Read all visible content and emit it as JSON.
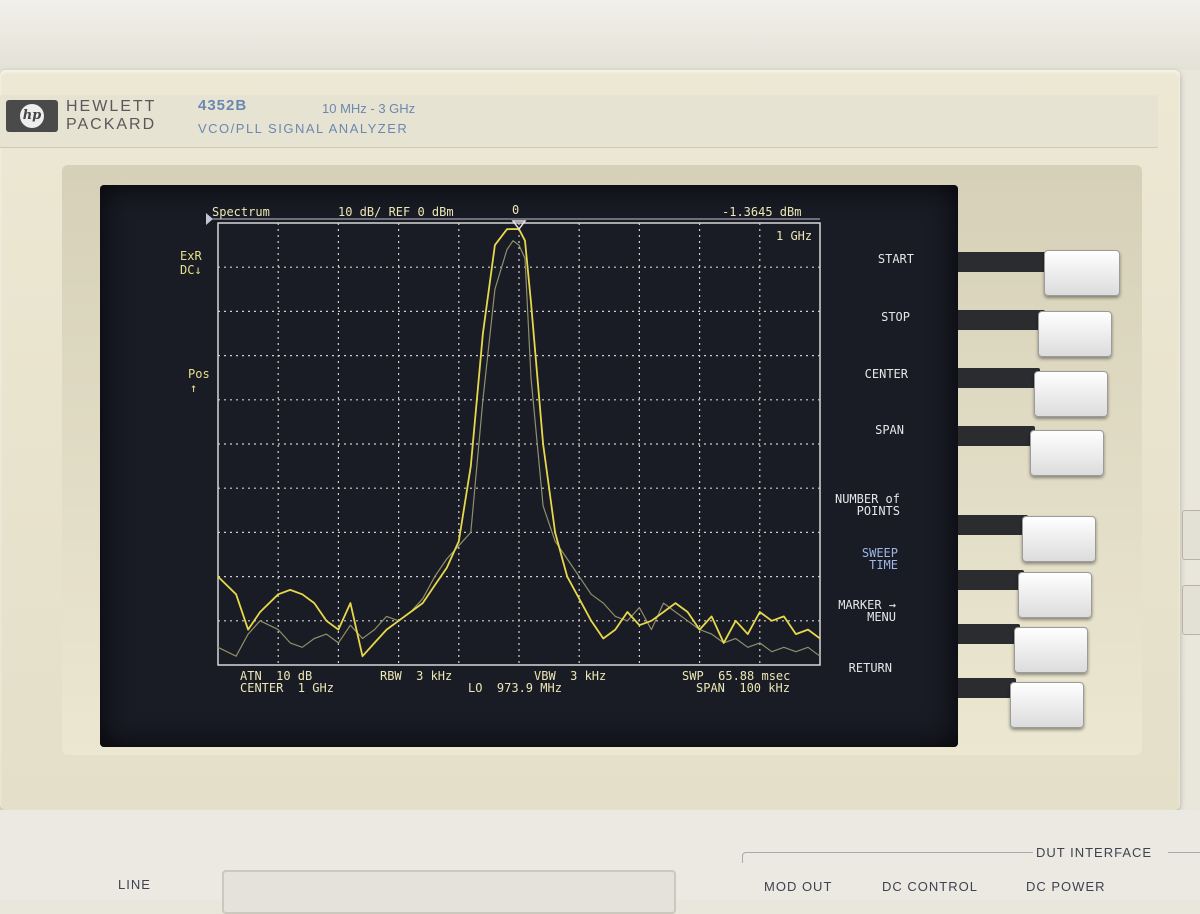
{
  "brand": {
    "line1": "HEWLETT",
    "line2": "PACKARD",
    "logo": "hp"
  },
  "instrument": {
    "model": "4352B",
    "range": "10 MHz - 3 GHz",
    "description": "VCO/PLL  SIGNAL  ANALYZER"
  },
  "screen": {
    "mode": "Spectrum",
    "scale": "10 dB/ REF 0 dBm",
    "marker_id": "0",
    "marker_value": "-1.3645 dBm",
    "marker_freq": "1 GHz",
    "left_annotations": {
      "exr_line1": "ExR",
      "exr_line2": "DC↓",
      "pos_line1": "Pos",
      "pos_line2": "↑"
    },
    "bottom": {
      "atn": "ATN  10 dB",
      "center": "CENTER  1 GHz",
      "rbw": "RBW  3 kHz",
      "lo": "LO  973.9 MHz",
      "vbw": "VBW  3 kHz",
      "swp": "SWP  65.88 msec",
      "span": "SPAN  100 kHz"
    }
  },
  "softkeys": [
    {
      "label": "START"
    },
    {
      "label": "STOP"
    },
    {
      "label": "CENTER"
    },
    {
      "label": "SPAN"
    },
    {
      "label": "NUMBER of\nPOINTS"
    },
    {
      "label": "SWEEP\nTIME"
    },
    {
      "label": "MARKER →\nMENU"
    },
    {
      "label": "RETURN"
    }
  ],
  "lower_panel": {
    "line_label": "LINE",
    "dut_interface": "DUT INTERFACE",
    "mod_out": "MOD OUT",
    "dc_control": "DC CONTROL",
    "dc_power": "DC POWER"
  },
  "chart_data": {
    "type": "line",
    "title": "Spectrum",
    "x": [
      -50,
      -47,
      -45,
      -43,
      -40,
      -38,
      -36,
      -34,
      -32,
      -30,
      -28,
      -26,
      -24,
      -22,
      -20,
      -18,
      -16,
      -14,
      -12,
      -10,
      -8,
      -6,
      -4,
      -2,
      -1,
      0,
      1,
      2,
      4,
      6,
      8,
      10,
      12,
      14,
      16,
      18,
      20,
      22,
      24,
      26,
      28,
      30,
      32,
      34,
      36,
      38,
      40,
      42,
      44,
      46,
      48,
      50
    ],
    "series": [
      {
        "values": [
          -80,
          -84,
          -92,
          -88,
          -84,
          -83,
          -84,
          -86,
          -90,
          -92,
          -86,
          -98,
          -95,
          -92,
          -90,
          -88,
          -86,
          -82,
          -78,
          -72,
          -55,
          -25,
          -5,
          -1.4,
          -1.36,
          -1.4,
          -4,
          -18,
          -50,
          -70,
          -80,
          -85,
          -90,
          -94,
          -92,
          -88,
          -91,
          -90,
          -88,
          -86,
          -88,
          -92,
          -89,
          -95,
          -90,
          -93,
          -88,
          -90,
          -89,
          -93,
          -92,
          -94
        ]
      },
      {
        "values": [
          -96,
          -98,
          -93,
          -90,
          -92,
          -95,
          -96,
          -94,
          -93,
          -95,
          -91,
          -94,
          -92,
          -89,
          -90,
          -88,
          -85,
          -80,
          -76,
          -73,
          -70,
          -40,
          -15,
          -6,
          -4,
          -5,
          -8,
          -35,
          -64,
          -72,
          -76,
          -80,
          -84,
          -86,
          -89,
          -90,
          -87,
          -92,
          -86,
          -88,
          -90,
          -92,
          -93,
          -95,
          -94,
          -96,
          -95,
          -97,
          -96,
          -97,
          -96,
          -98
        ]
      }
    ],
    "ylim": [
      -100,
      0
    ],
    "xlim": [
      -50,
      50
    ],
    "grid": true
  }
}
